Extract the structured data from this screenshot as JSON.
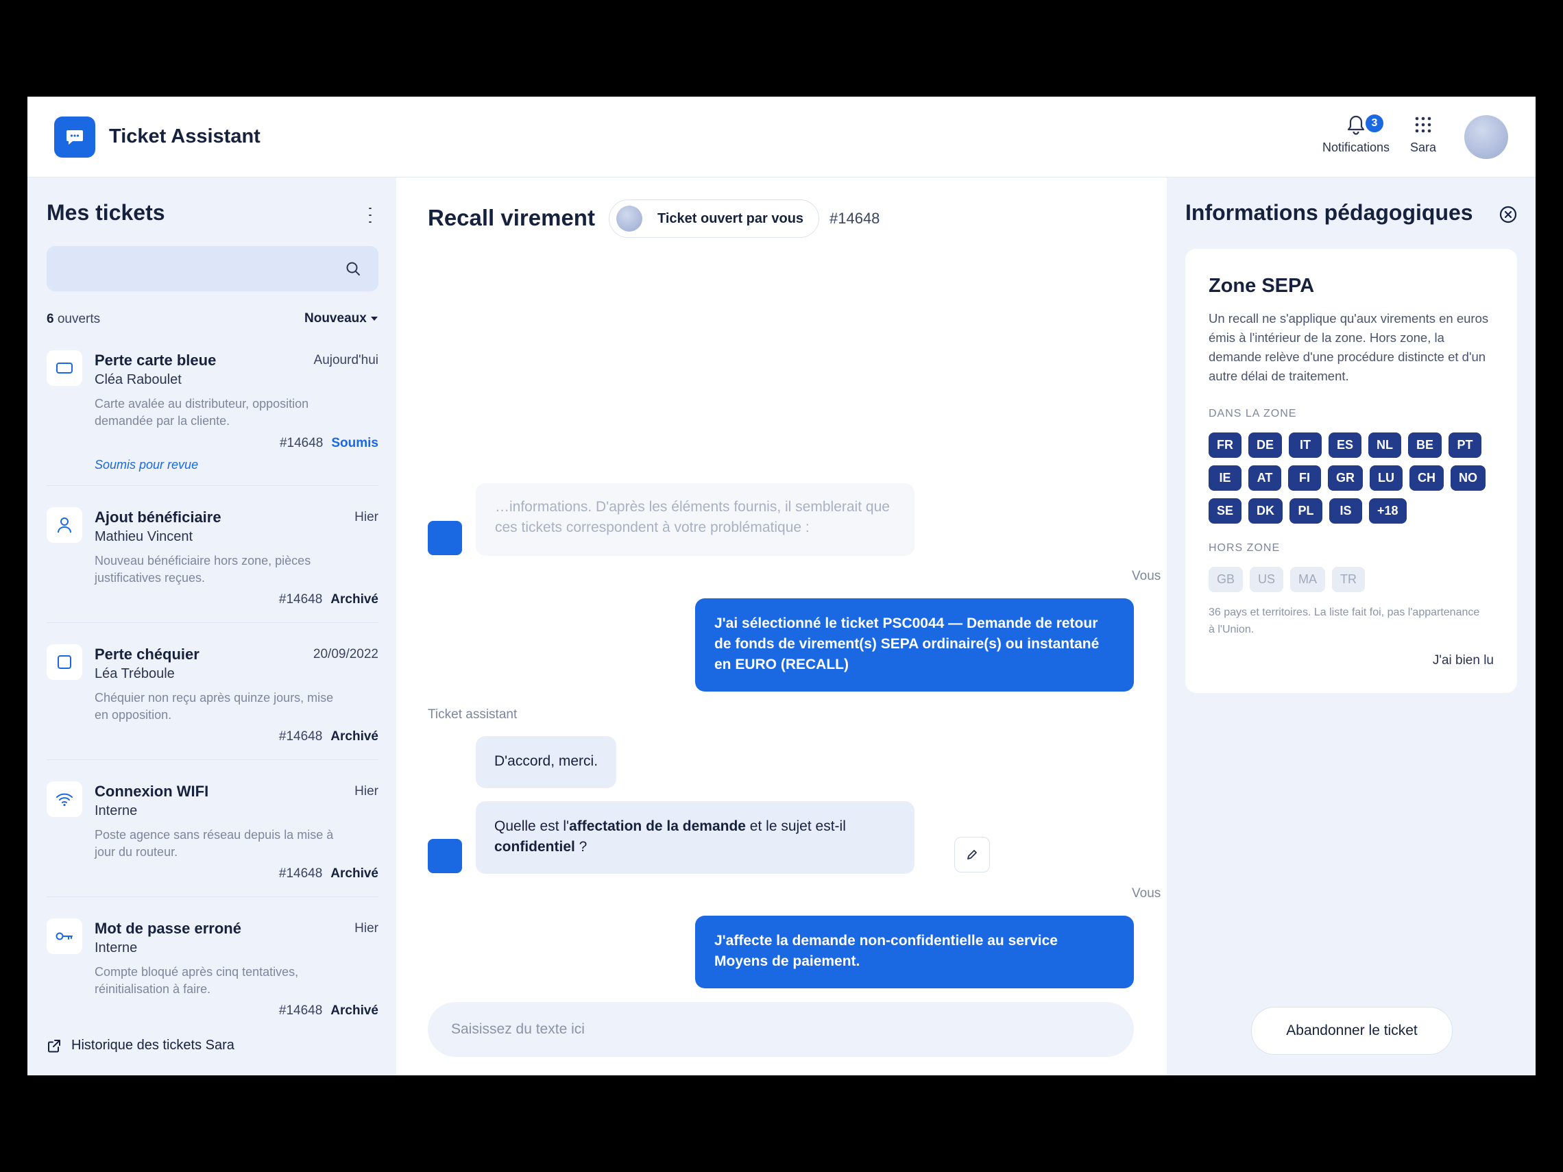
{
  "header": {
    "app_title": "Ticket Assistant",
    "notifications_label": "Notifications",
    "notifications_count": "3",
    "apps_label": "Sara"
  },
  "left": {
    "title": "Mes tickets",
    "search_placeholder": "",
    "open_count": "6",
    "open_label": " ouverts",
    "sort_label": "Nouveaux",
    "tickets": [
      {
        "icon": "card-icon",
        "title": "Perte carte bleue",
        "date": "Aujourd'hui",
        "who": "Cléa Raboulet",
        "desc": "Carte avalée au distributeur, opposition demandée par la cliente.",
        "num": "#14648",
        "status": "Soumis",
        "review": "Soumis pour revue"
      },
      {
        "icon": "user-icon",
        "title": "Ajout bénéficiaire",
        "date": "Hier",
        "who": "Mathieu Vincent",
        "desc": "Nouveau bénéficiaire hors zone, pièces justificatives reçues.",
        "num": "#14648",
        "status": "Archivé"
      },
      {
        "icon": "checkbook-icon",
        "title": "Perte chéquier",
        "date": "20/09/2022",
        "who": "Léa Tréboule",
        "desc": "Chéquier non reçu après quinze jours, mise en opposition.",
        "num": "#14648",
        "status": "Archivé"
      },
      {
        "icon": "wifi-icon",
        "title": "Connexion WIFI",
        "date": "Hier",
        "who": "Interne",
        "desc": "Poste agence sans réseau depuis la mise à jour du routeur.",
        "num": "#14648",
        "status": "Archivé"
      },
      {
        "icon": "key-icon",
        "title": "Mot de passe erroné",
        "date": "Hier",
        "who": "Interne",
        "desc": "Compte bloqué après cinq tentatives, réinitialisation à faire.",
        "num": "#14648",
        "status": "Archivé"
      }
    ],
    "history_link": "Historique des tickets Sara"
  },
  "center": {
    "title": "Recall virement",
    "opened_by": "Ticket ouvert par vous",
    "ticket_number": "#14648",
    "messages": {
      "faded": "…informations. D'après les éléments fournis, il semblerait que ces tickets correspondent à votre problématique :",
      "you_label": "Vous",
      "user1": "J'ai sélectionné le ticket PSC0044 — Demande de retour de fonds de virement(s) SEPA ordinaire(s) ou instantané en EURO (RECALL)",
      "assistant_label": "Ticket assistant",
      "bot1": "D'accord, merci.",
      "bot2_pre": "Quelle est l'",
      "bot2_bold1": "affectation de la demande",
      "bot2_mid": " et le sujet est-il ",
      "bot2_bold2": "confidentiel",
      "bot2_post": " ?",
      "user2": "J'affecte la demande non-confidentielle au service Moyens de paiement."
    },
    "input_placeholder": "Saisissez du texte ici"
  },
  "right": {
    "title": "Informations pédagogiques",
    "card_title": "Zone SEPA",
    "intro": "Un recall ne s'applique qu'aux virements en euros émis à l'intérieur de la zone. Hors zone, la demande relève d'une procédure distincte et d'un autre délai de traitement.",
    "in_zone_label": "DANS LA ZONE",
    "in_zone": [
      "FR",
      "DE",
      "IT",
      "ES",
      "NL",
      "BE",
      "PT",
      "IE",
      "AT",
      "FI",
      "GR",
      "LU",
      "CH",
      "NO",
      "SE",
      "DK",
      "PL",
      "IS",
      "+18"
    ],
    "out_zone_label": "HORS ZONE",
    "out_zone": [
      "GB",
      "US",
      "MA",
      "TR"
    ],
    "note": "36 pays et territoires. La liste fait foi, pas l'appartenance à l'Union.",
    "ack": "J'ai bien lu",
    "abandon": "Abandonner le ticket"
  },
  "colors": {
    "accent": "#1b68e3",
    "chip_in": "#223b8a",
    "panel": "#eef2fb"
  }
}
